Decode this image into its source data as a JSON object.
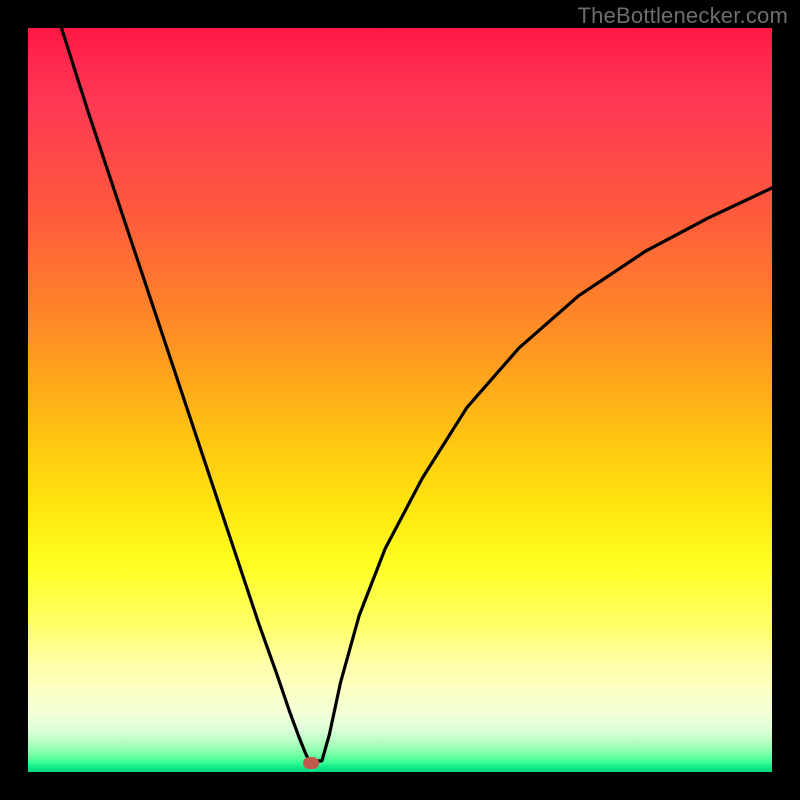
{
  "watermark": "TheBottlenecker.com",
  "marker": {
    "x_frac": 0.38,
    "y_frac": 0.988
  },
  "chart_data": {
    "type": "line",
    "title": "",
    "xlabel": "",
    "ylabel": "",
    "xlim": [
      0,
      1
    ],
    "ylim": [
      0,
      1
    ],
    "note": "Unlabeled axes; values are fractional positions within the plot area (0 = left/top, 1 = right/bottom on screen; y increases downward).",
    "series": [
      {
        "name": "left-branch",
        "x": [
          0.045,
          0.08,
          0.12,
          0.16,
          0.2,
          0.24,
          0.28,
          0.31,
          0.335,
          0.352,
          0.365,
          0.373,
          0.378
        ],
        "y": [
          0.0,
          0.11,
          0.23,
          0.35,
          0.47,
          0.59,
          0.71,
          0.8,
          0.87,
          0.92,
          0.955,
          0.975,
          0.985
        ]
      },
      {
        "name": "floor",
        "x": [
          0.378,
          0.395
        ],
        "y": [
          0.985,
          0.985
        ]
      },
      {
        "name": "right-branch",
        "x": [
          0.395,
          0.405,
          0.42,
          0.445,
          0.48,
          0.53,
          0.59,
          0.66,
          0.74,
          0.83,
          0.915,
          1.0
        ],
        "y": [
          0.985,
          0.95,
          0.88,
          0.79,
          0.7,
          0.605,
          0.51,
          0.43,
          0.36,
          0.3,
          0.255,
          0.215
        ]
      }
    ],
    "background_gradient": {
      "orientation": "vertical",
      "stops": [
        {
          "pos": 0.0,
          "color": "#ff1744"
        },
        {
          "pos": 0.25,
          "color": "#ff5a3c"
        },
        {
          "pos": 0.55,
          "color": "#ffc411"
        },
        {
          "pos": 0.8,
          "color": "#ffff66"
        },
        {
          "pos": 0.95,
          "color": "#d9ffd8"
        },
        {
          "pos": 1.0,
          "color": "#05d882"
        }
      ]
    },
    "marker": {
      "x": 0.38,
      "y": 0.988,
      "color": "#c05a4a"
    }
  }
}
